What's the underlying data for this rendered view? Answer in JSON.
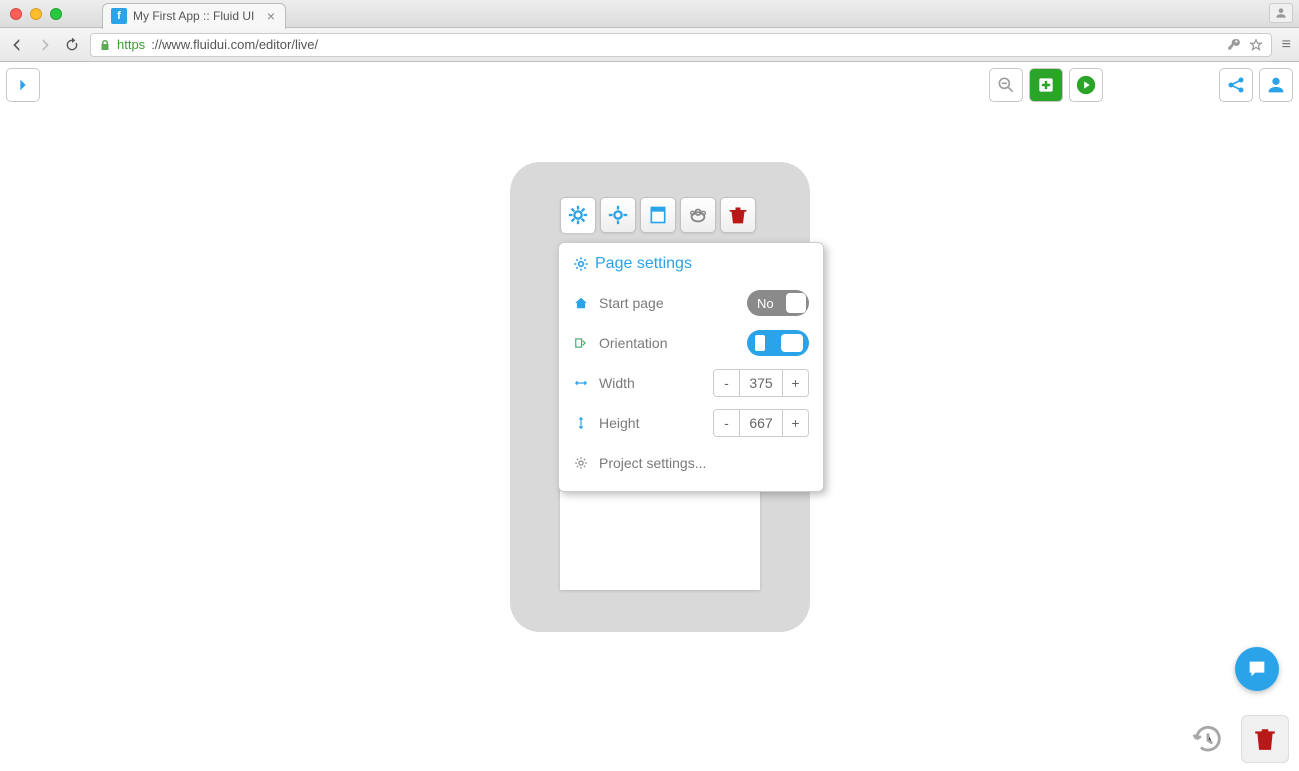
{
  "browser": {
    "tab_title": "My First App :: Fluid UI",
    "url_secure_prefix": "https",
    "url_rest": "://www.fluidui.com/editor/live/",
    "favicon_letter": "f"
  },
  "popover": {
    "title": "Page settings",
    "start_page": {
      "label": "Start page",
      "value_text": "No",
      "value": false
    },
    "orientation": {
      "label": "Orientation"
    },
    "width": {
      "label": "Width",
      "value": "375"
    },
    "height": {
      "label": "Height",
      "value": "667"
    },
    "project_settings": "Project settings..."
  },
  "steppers": {
    "minus": "-",
    "plus": "+"
  }
}
